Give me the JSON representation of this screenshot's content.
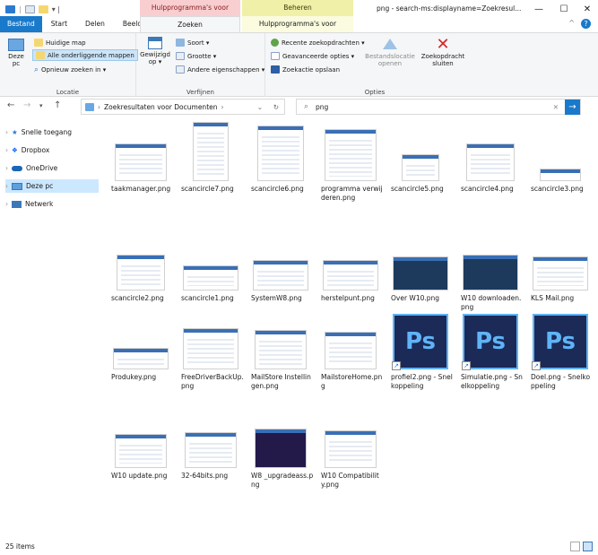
{
  "window": {
    "title": "png - search-ms:displayname=Zoekresul...",
    "minimize": "—",
    "maximize": "☐",
    "close": "✕"
  },
  "contextual": {
    "search_tools": "Hulpprogramma's voor zoeken",
    "manage": "Beheren",
    "search_tab": "Zoeken",
    "picture_tools_tab": "Hulpprogramma's voor afbeeldingen"
  },
  "tabs": [
    "Bestand",
    "Start",
    "Delen",
    "Beeld"
  ],
  "ribbon": {
    "location": {
      "label": "Locatie",
      "this_pc": "Deze pc",
      "current_folder": "Huidige map",
      "all_subfolders": "Alle onderliggende mappen",
      "search_again": "Opnieuw zoeken in ▾"
    },
    "refine": {
      "label": "Verfijnen",
      "modified": "Gewijzigd op ▾",
      "kind": "Soort ▾",
      "size": "Grootte ▾",
      "other": "Andere eigenschappen ▾"
    },
    "options": {
      "label": "Opties",
      "recent": "Recente zoekopdrachten ▾",
      "advanced": "Geavanceerde opties ▾",
      "save": "Zoekactie opslaan",
      "open_location": "Bestandslocatie openen",
      "close_search": "Zoekopdracht sluiten"
    }
  },
  "address": {
    "path": "Zoekresultaten voor Documenten",
    "search_value": "png"
  },
  "sidebar": {
    "items": [
      "Snelle toegang",
      "Dropbox",
      "OneDrive",
      "Deze pc",
      "Netwerk"
    ]
  },
  "files": [
    {
      "name": "taakmanager.png"
    },
    {
      "name": "scancircle7.png"
    },
    {
      "name": "scancircle6.png"
    },
    {
      "name": "programma verwijderen.png"
    },
    {
      "name": "scancircle5.png"
    },
    {
      "name": "scancircle4.png"
    },
    {
      "name": "scancircle3.png"
    },
    {
      "name": "scancircle2.png"
    },
    {
      "name": "scancircle1.png"
    },
    {
      "name": "SystemW8.png"
    },
    {
      "name": "herstelpunt.png"
    },
    {
      "name": "Over W10.png"
    },
    {
      "name": "W10 downloaden.png"
    },
    {
      "name": "KLS Mail.png"
    },
    {
      "name": "Produkey.png"
    },
    {
      "name": "FreeDriverBackUp.png"
    },
    {
      "name": "MailStore Instellingen.png"
    },
    {
      "name": "MailstoreHome.png"
    },
    {
      "name": "profiel2.png - Snelkoppeling"
    },
    {
      "name": "Simulatie.png - Snelkoppeling"
    },
    {
      "name": "Doel.png - Snelkoppeling"
    },
    {
      "name": "W10 update.png"
    },
    {
      "name": "32-64bits.png"
    },
    {
      "name": "W8 _upgradeass.png"
    },
    {
      "name": "W10 Compatibility.png"
    }
  ],
  "ps_label": "Ps",
  "status": {
    "count": "25 items"
  },
  "colors": {
    "accent": "#1979ca",
    "search_tools": "#f8ced0",
    "manage": "#f0f0a8",
    "ps_bg": "#1c2a58",
    "ps_text": "#5fb4f7",
    "highlight": "#fff39b"
  }
}
